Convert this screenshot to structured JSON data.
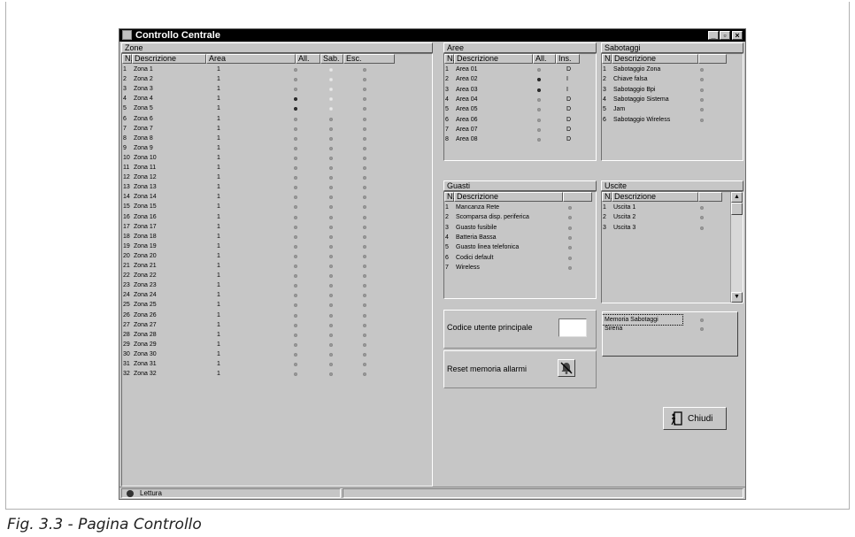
{
  "window": {
    "title": "Controllo Centrale"
  },
  "zone": {
    "title": "Zone",
    "headers": [
      "N.",
      "Descrizione",
      "Area",
      "All.",
      "Sab.",
      "Esc."
    ],
    "rows": [
      {
        "n": "1",
        "desc": "Zona 1",
        "area": "1",
        "all": "grey",
        "sab": "white",
        "esc": "grey"
      },
      {
        "n": "2",
        "desc": "Zona 2",
        "area": "1",
        "all": "grey",
        "sab": "white",
        "esc": "grey"
      },
      {
        "n": "3",
        "desc": "Zona 3",
        "area": "1",
        "all": "grey",
        "sab": "white",
        "esc": "grey"
      },
      {
        "n": "4",
        "desc": "Zona 4",
        "area": "1",
        "all": "on",
        "sab": "white",
        "esc": "grey"
      },
      {
        "n": "5",
        "desc": "Zona 5",
        "area": "1",
        "all": "on",
        "sab": "white",
        "esc": "grey"
      },
      {
        "n": "6",
        "desc": "Zona 6",
        "area": "1",
        "all": "grey",
        "sab": "grey",
        "esc": "grey"
      },
      {
        "n": "7",
        "desc": "Zona 7",
        "area": "1",
        "all": "grey",
        "sab": "grey",
        "esc": "grey"
      },
      {
        "n": "8",
        "desc": "Zona 8",
        "area": "1",
        "all": "grey",
        "sab": "grey",
        "esc": "grey"
      },
      {
        "n": "9",
        "desc": "Zona 9",
        "area": "1",
        "all": "grey",
        "sab": "grey",
        "esc": "grey"
      },
      {
        "n": "10",
        "desc": "Zona 10",
        "area": "1",
        "all": "grey",
        "sab": "grey",
        "esc": "grey"
      },
      {
        "n": "11",
        "desc": "Zona 11",
        "area": "1",
        "all": "grey",
        "sab": "grey",
        "esc": "grey"
      },
      {
        "n": "12",
        "desc": "Zona 12",
        "area": "1",
        "all": "grey",
        "sab": "grey",
        "esc": "grey"
      },
      {
        "n": "13",
        "desc": "Zona 13",
        "area": "1",
        "all": "grey",
        "sab": "grey",
        "esc": "grey"
      },
      {
        "n": "14",
        "desc": "Zona 14",
        "area": "1",
        "all": "grey",
        "sab": "grey",
        "esc": "grey"
      },
      {
        "n": "15",
        "desc": "Zona 15",
        "area": "1",
        "all": "grey",
        "sab": "grey",
        "esc": "grey"
      },
      {
        "n": "16",
        "desc": "Zona 16",
        "area": "1",
        "all": "grey",
        "sab": "grey",
        "esc": "grey"
      },
      {
        "n": "17",
        "desc": "Zona 17",
        "area": "1",
        "all": "grey",
        "sab": "grey",
        "esc": "grey"
      },
      {
        "n": "18",
        "desc": "Zona 18",
        "area": "1",
        "all": "grey",
        "sab": "grey",
        "esc": "grey"
      },
      {
        "n": "19",
        "desc": "Zona 19",
        "area": "1",
        "all": "grey",
        "sab": "grey",
        "esc": "grey"
      },
      {
        "n": "20",
        "desc": "Zona 20",
        "area": "1",
        "all": "grey",
        "sab": "grey",
        "esc": "grey"
      },
      {
        "n": "21",
        "desc": "Zona 21",
        "area": "1",
        "all": "grey",
        "sab": "grey",
        "esc": "grey"
      },
      {
        "n": "22",
        "desc": "Zona 22",
        "area": "1",
        "all": "grey",
        "sab": "grey",
        "esc": "grey"
      },
      {
        "n": "23",
        "desc": "Zona 23",
        "area": "1",
        "all": "grey",
        "sab": "grey",
        "esc": "grey"
      },
      {
        "n": "24",
        "desc": "Zona 24",
        "area": "1",
        "all": "grey",
        "sab": "grey",
        "esc": "grey"
      },
      {
        "n": "25",
        "desc": "Zona 25",
        "area": "1",
        "all": "grey",
        "sab": "grey",
        "esc": "grey"
      },
      {
        "n": "26",
        "desc": "Zona 26",
        "area": "1",
        "all": "grey",
        "sab": "grey",
        "esc": "grey"
      },
      {
        "n": "27",
        "desc": "Zona 27",
        "area": "1",
        "all": "grey",
        "sab": "grey",
        "esc": "grey"
      },
      {
        "n": "28",
        "desc": "Zona 28",
        "area": "1",
        "all": "grey",
        "sab": "grey",
        "esc": "grey"
      },
      {
        "n": "29",
        "desc": "Zona 29",
        "area": "1",
        "all": "grey",
        "sab": "grey",
        "esc": "grey"
      },
      {
        "n": "30",
        "desc": "Zona 30",
        "area": "1",
        "all": "grey",
        "sab": "grey",
        "esc": "grey"
      },
      {
        "n": "31",
        "desc": "Zona 31",
        "area": "1",
        "all": "grey",
        "sab": "grey",
        "esc": "grey"
      },
      {
        "n": "32",
        "desc": "Zona 32",
        "area": "1",
        "all": "grey",
        "sab": "grey",
        "esc": "grey"
      }
    ]
  },
  "aree": {
    "title": "Aree",
    "headers": [
      "N.",
      "Descrizione",
      "All.",
      "Ins."
    ],
    "rows": [
      {
        "n": "1",
        "desc": "Area 01",
        "all": "grey",
        "ins": "D"
      },
      {
        "n": "2",
        "desc": "Area 02",
        "all": "on",
        "ins": "I"
      },
      {
        "n": "3",
        "desc": "Area 03",
        "all": "on",
        "ins": "I"
      },
      {
        "n": "4",
        "desc": "Area 04",
        "all": "grey",
        "ins": "D"
      },
      {
        "n": "5",
        "desc": "Area 05",
        "all": "grey",
        "ins": "D"
      },
      {
        "n": "6",
        "desc": "Area 06",
        "all": "grey",
        "ins": "D"
      },
      {
        "n": "7",
        "desc": "Area 07",
        "all": "grey",
        "ins": "D"
      },
      {
        "n": "8",
        "desc": "Area 08",
        "all": "grey",
        "ins": "D"
      }
    ]
  },
  "sabotaggi": {
    "title": "Sabotaggi",
    "headers": [
      "N.",
      "Descrizione",
      ""
    ],
    "rows": [
      {
        "n": "1",
        "desc": "Sabotaggio Zona"
      },
      {
        "n": "2",
        "desc": "Chiave falsa"
      },
      {
        "n": "3",
        "desc": "Sabotaggio Bpi"
      },
      {
        "n": "4",
        "desc": "Sabotaggio Sistema"
      },
      {
        "n": "5",
        "desc": "Jam"
      },
      {
        "n": "6",
        "desc": "Sabotaggio Wireless"
      }
    ]
  },
  "guasti": {
    "title": "Guasti",
    "headers": [
      "N.",
      "Descrizione",
      ""
    ],
    "rows": [
      {
        "n": "1",
        "desc": "Mancanza Rete"
      },
      {
        "n": "2",
        "desc": "Scomparsa disp. periferica"
      },
      {
        "n": "3",
        "desc": "Guasto fusibile"
      },
      {
        "n": "4",
        "desc": "Batteria Bassa"
      },
      {
        "n": "5",
        "desc": "Guasto linea telefonica"
      },
      {
        "n": "6",
        "desc": "Codici default"
      },
      {
        "n": "7",
        "desc": "Wireless"
      }
    ]
  },
  "uscite": {
    "title": "Uscite",
    "headers": [
      "N.",
      "Descrizione",
      ""
    ],
    "rows": [
      {
        "n": "1",
        "desc": "Uscita 1"
      },
      {
        "n": "2",
        "desc": "Uscita 2"
      },
      {
        "n": "3",
        "desc": "Uscita 3"
      }
    ]
  },
  "codice": {
    "label": "Codice utente principale",
    "value": ""
  },
  "reset": {
    "label": "Reset memoria allarmi"
  },
  "memoria": {
    "items": [
      {
        "label": "Memoria Sabotaggi"
      },
      {
        "label": "Sirena"
      }
    ]
  },
  "chiudi": {
    "label": "Chiudi"
  },
  "status": {
    "text": "Lettura"
  },
  "caption": "Fig. 3.3 - Pagina Controllo"
}
